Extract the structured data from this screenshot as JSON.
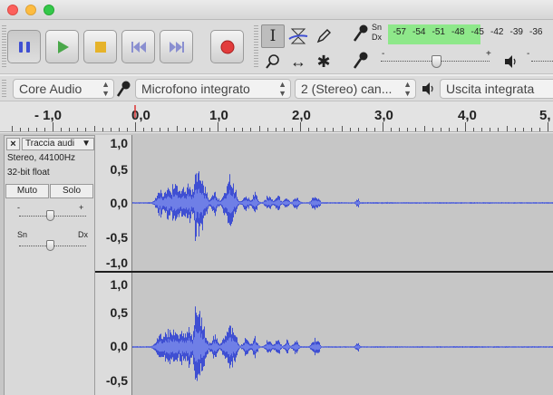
{
  "window": {
    "close": "close",
    "minimize": "minimize",
    "zoom": "zoom"
  },
  "transport": {
    "pause": "pause-icon",
    "play": "play-icon",
    "stop": "stop-icon",
    "skip_start": "skip-to-start-icon",
    "skip_end": "skip-to-end-icon",
    "record": "record-icon"
  },
  "tools": {
    "selection": "I",
    "envelope": "envelope-icon",
    "draw": "pencil-icon",
    "zoom": "magnifier-icon",
    "timeshift": "↔",
    "multi": "✱"
  },
  "meter": {
    "channel_left": "Sn",
    "channel_right": "Dx",
    "scale": [
      "-57",
      "-54",
      "-51",
      "-48",
      "-45",
      "-42",
      "-39",
      "-36"
    ]
  },
  "mixer": {
    "minus": "-",
    "plus": "+"
  },
  "devices": {
    "host": "Core Audio",
    "input": "Microfono integrato",
    "channels": "2 (Stereo) can...",
    "output": "Uscita integrata"
  },
  "ruler": {
    "labels": [
      "- 1,0",
      "0,0",
      "1,0",
      "2,0",
      "3,0",
      "4,0",
      "5,"
    ]
  },
  "track": {
    "name": "Traccia audi",
    "format_line1": "Stereo, 44100Hz",
    "format_line2": "32-bit float",
    "mute": "Muto",
    "solo": "Solo",
    "gain_minus": "-",
    "gain_plus": "+",
    "pan_left": "Sn",
    "pan_right": "Dx",
    "close": "×",
    "dropdown": "▼"
  },
  "vscale_top": [
    "1,0",
    "0,5",
    "0,0",
    "-0,5",
    "-1,0"
  ],
  "vscale_bottom": [
    "1,0",
    "0,5",
    "0,0",
    "-0,5"
  ],
  "colors": {
    "waveform": "#3f4fd2",
    "waveform_light": "#6f7fe6",
    "record": "#e23c3c",
    "meter_green": "#8ee88a",
    "play": "#4aa84a",
    "stop": "#e6b32a"
  }
}
